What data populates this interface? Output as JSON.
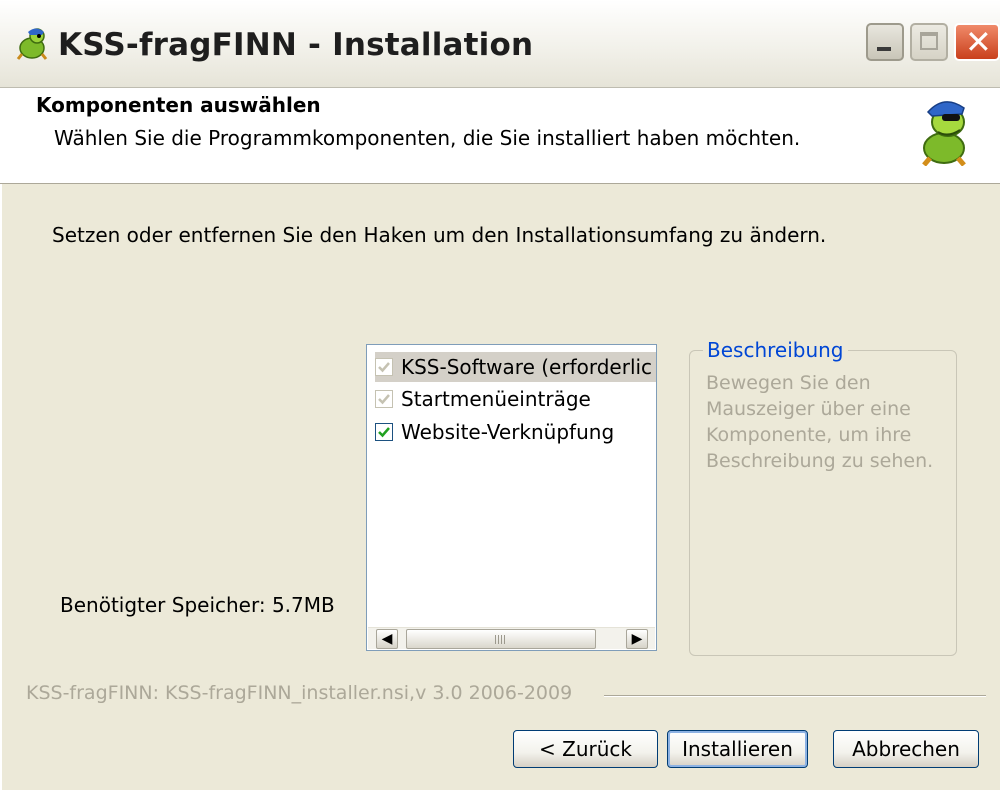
{
  "window": {
    "title": "KSS-fragFINN - Installation",
    "controls": {
      "minimize": "minimize",
      "maximize": "maximize",
      "close": "close"
    }
  },
  "header": {
    "title": "Komponenten auswählen",
    "subtitle": "Wählen Sie die Programmkomponenten, die Sie installiert haben möchten."
  },
  "instruction": "Setzen oder entfernen Sie den Haken um den Installationsumfang zu ändern.",
  "components": [
    {
      "label": "KSS-Software (erforderlic",
      "checked": true,
      "disabled": true,
      "selected": true
    },
    {
      "label": "Startmenüeinträge",
      "checked": true,
      "disabled": true,
      "selected": false
    },
    {
      "label": "Website-Verknüpfung",
      "checked": true,
      "disabled": false,
      "selected": false
    }
  ],
  "description": {
    "legend": "Beschreibung",
    "text": "Bewegen Sie den Mauszeiger über eine Komponente, um ihre Beschreibung zu sehen."
  },
  "space_required": "Benötigter Speicher: 5.7MB",
  "branding": "KSS-fragFINN: KSS-fragFINN_installer.nsi,v  3.0 2006-2009",
  "buttons": {
    "back": "< Zurück",
    "install": "Installieren",
    "cancel": "Abbrechen"
  },
  "colors": {
    "dialog_bg": "#ECE9D8",
    "accent_blue": "#0046D5",
    "disabled_text": "#ACA899",
    "check_green": "#21A121"
  },
  "icons": [
    "turtle-mascot-icon",
    "minimize-icon",
    "maximize-icon",
    "close-icon",
    "checkmark-icon",
    "scroll-left-icon",
    "scroll-right-icon"
  ]
}
